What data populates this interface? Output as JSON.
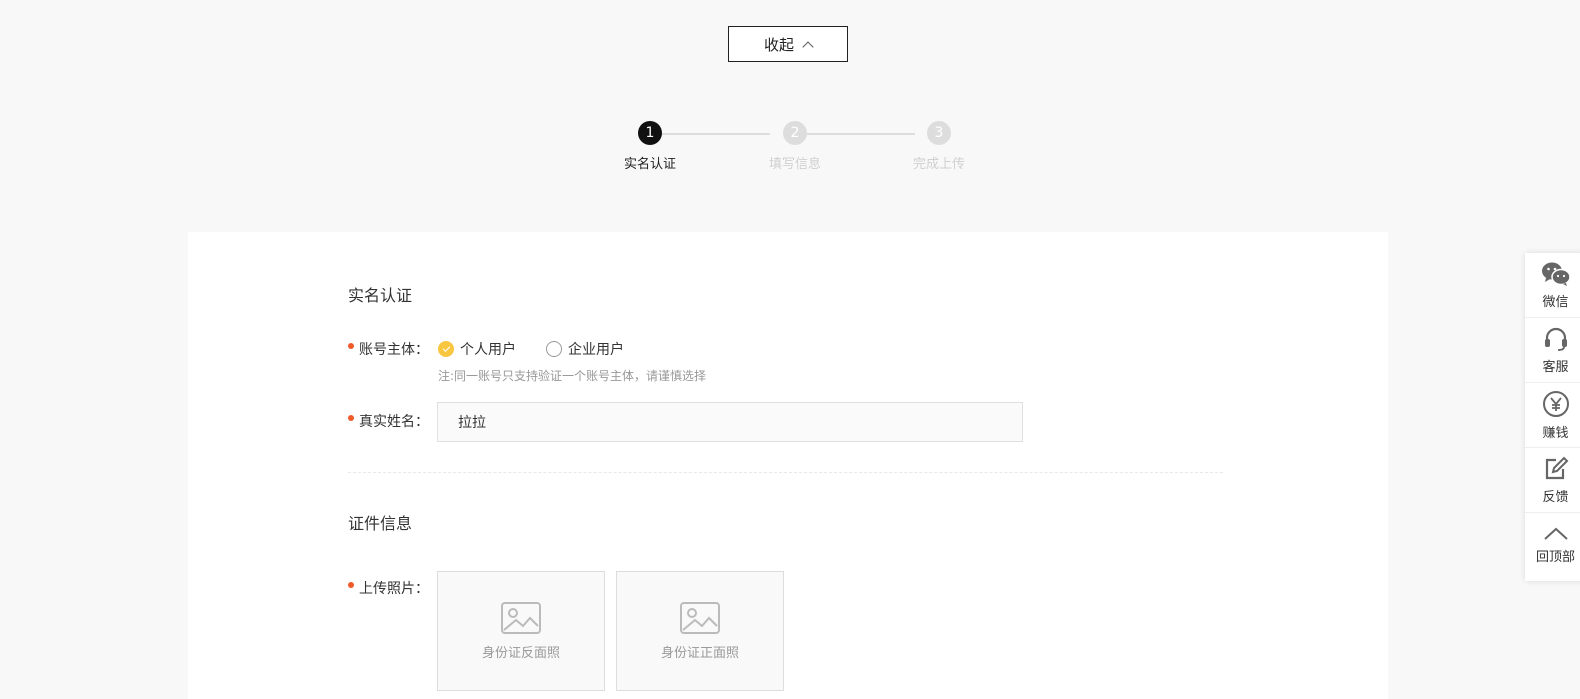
{
  "header": {
    "collapse_label": "收起"
  },
  "stepper": {
    "steps": [
      {
        "num": "1",
        "label": "实名认证",
        "state": "active"
      },
      {
        "num": "2",
        "label": "填写信息",
        "state": "inactive"
      },
      {
        "num": "3",
        "label": "完成上传",
        "state": "inactive"
      }
    ]
  },
  "form": {
    "section1_title": "实名认证",
    "account_label": "账号主体：",
    "account_options": [
      "个人用户",
      "企业用户"
    ],
    "account_selected": "个人用户",
    "account_note": "注:同一账号只支持验证一个账号主体，请谨慎选择",
    "name_label": "真实姓名：",
    "name_value": "拉拉",
    "section2_title": "证件信息",
    "upload_label": "上传照片：",
    "upload_back": "身份证反面照",
    "upload_front": "身份证正面照"
  },
  "sidebar": {
    "items": [
      {
        "label": "微信",
        "icon": "wechat-icon"
      },
      {
        "label": "客服",
        "icon": "headset-icon"
      },
      {
        "label": "赚钱",
        "icon": "yen-icon"
      },
      {
        "label": "反馈",
        "icon": "edit-icon"
      },
      {
        "label": "回顶部",
        "icon": "chevron-up-icon"
      }
    ]
  },
  "colors": {
    "accent": "#f9c640",
    "required": "#f05a28",
    "step_active": "#111111",
    "step_inactive": "#dddddd"
  }
}
